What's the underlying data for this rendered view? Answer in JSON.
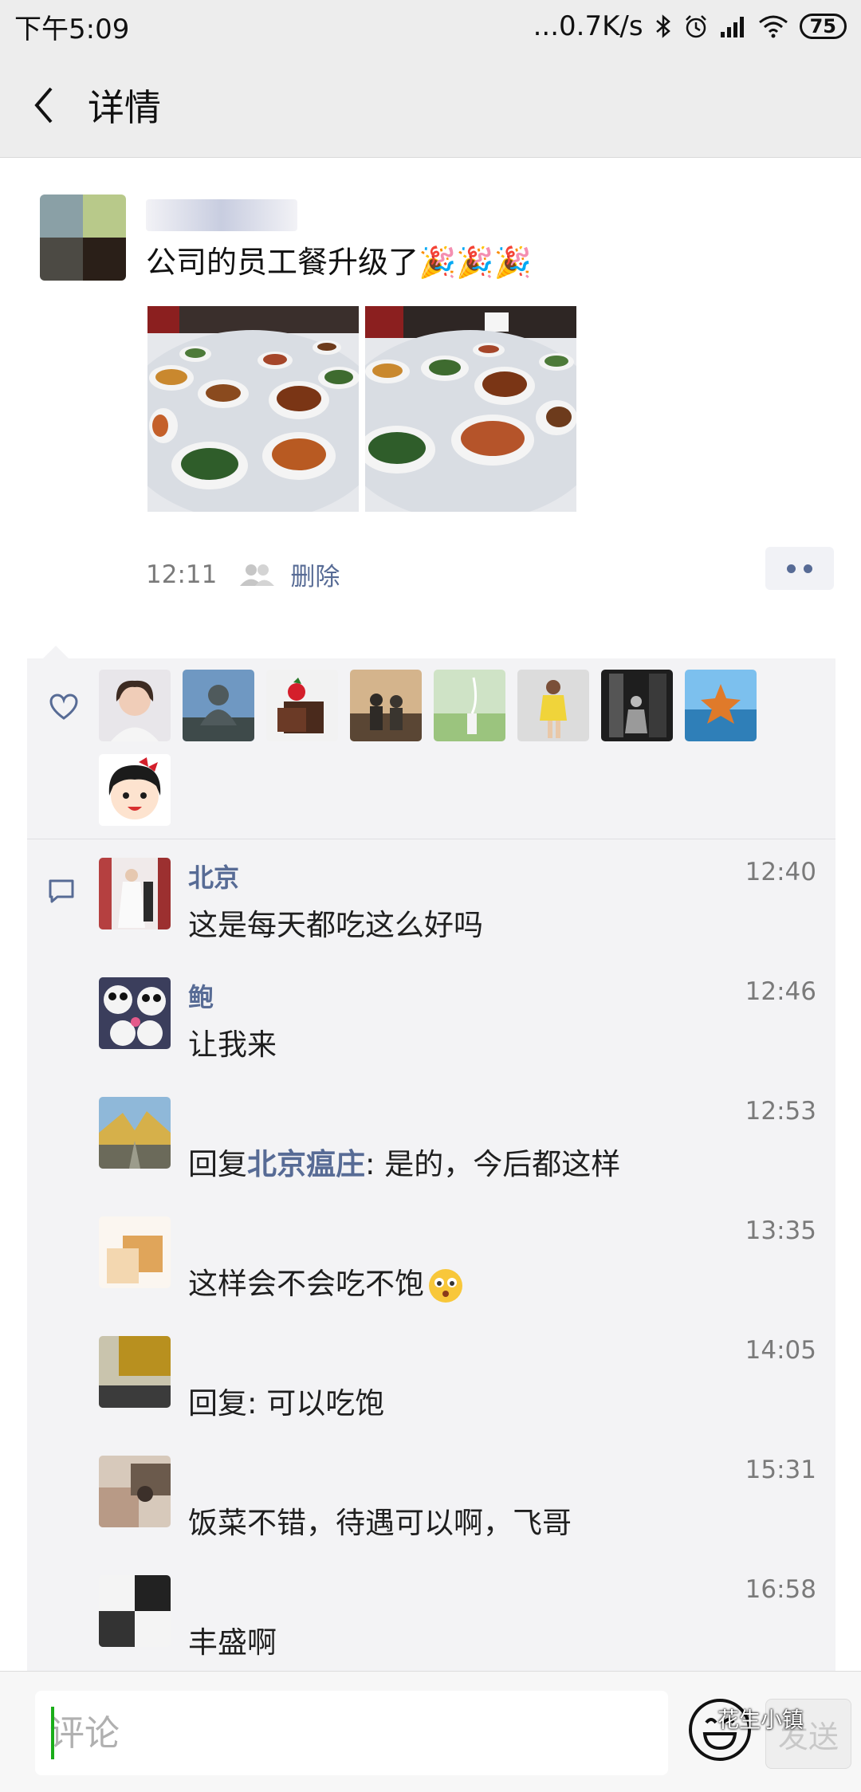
{
  "status_bar": {
    "time": "下午5:09",
    "network_speed": "...0.7K/s",
    "battery": "75"
  },
  "nav": {
    "title": "详情"
  },
  "post": {
    "text": "公司的员工餐升级了🎉🎉🎉",
    "time": "12:11",
    "delete_label": "删除",
    "photo_icons": [
      "food-photo-1",
      "food-photo-2"
    ]
  },
  "likes": {
    "avatars": [
      "woman",
      "buddha-statue",
      "chocolate",
      "couple-sunset",
      "green-field",
      "girl-yellow-dress",
      "black-white-photo",
      "starfish",
      "chibi-maruko"
    ]
  },
  "comments": [
    {
      "name": "北京",
      "time": "12:40",
      "text": "这是每天都吃这么好吗"
    },
    {
      "name": "鲍",
      "time": "12:46",
      "text": "让我来"
    },
    {
      "name": "",
      "time": "12:53",
      "reply_prefix": "回复",
      "reply_to": "北京瘟庄",
      "text": ": 是的，今后都这样"
    },
    {
      "name": "",
      "time": "13:35",
      "text": "这样会不会吃不饱"
    },
    {
      "name": "",
      "time": "14:05",
      "reply_prefix": "回复",
      "reply_to": "",
      "text": ": 可以吃饱"
    },
    {
      "name": "",
      "time": "15:31",
      "text": "饭菜不错，待遇可以啊，飞哥"
    },
    {
      "name": "",
      "time": "16:58",
      "text": "丰盛啊"
    }
  ],
  "input": {
    "placeholder": "评论",
    "send_label": "发送"
  },
  "watermark": "花生小镇"
}
